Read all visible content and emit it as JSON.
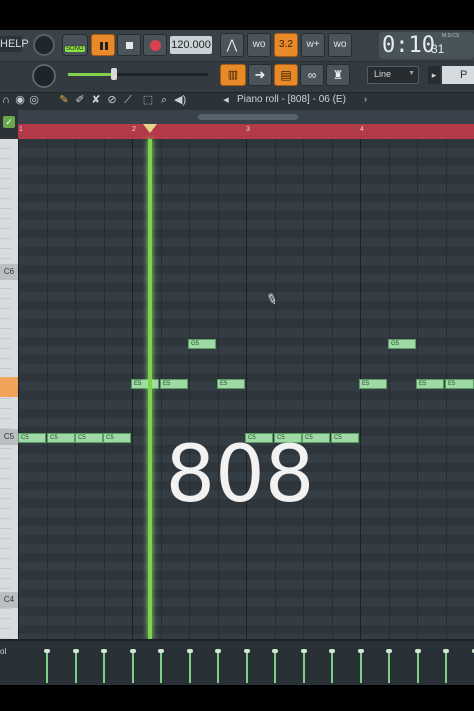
{
  "menu": {
    "help_label": "HELP"
  },
  "transport": {
    "song_mode": "SONG",
    "tempo": "120.000",
    "time": "0:10",
    "time_small": "31",
    "time_unit": "M:S:CS"
  },
  "snap": {
    "mode": "Line"
  },
  "toolbar": {
    "pattern_label": "P"
  },
  "pianoroll": {
    "title": "Piano roll - [808] - 06 (E)"
  },
  "ruler": {
    "bars": [
      "1",
      "2",
      "3",
      "4"
    ]
  },
  "keys": [
    "C6",
    "C5",
    "C4"
  ],
  "notes": {
    "g5": "G5",
    "e5": "E5",
    "c5": "C5"
  },
  "overlay": {
    "text": "808"
  },
  "velocity": {
    "label": "ol"
  },
  "colors": {
    "note": "#9fd9a6",
    "playhead": "#7ed34f",
    "ruler": "#b33a48",
    "accent": "#e8892a"
  }
}
